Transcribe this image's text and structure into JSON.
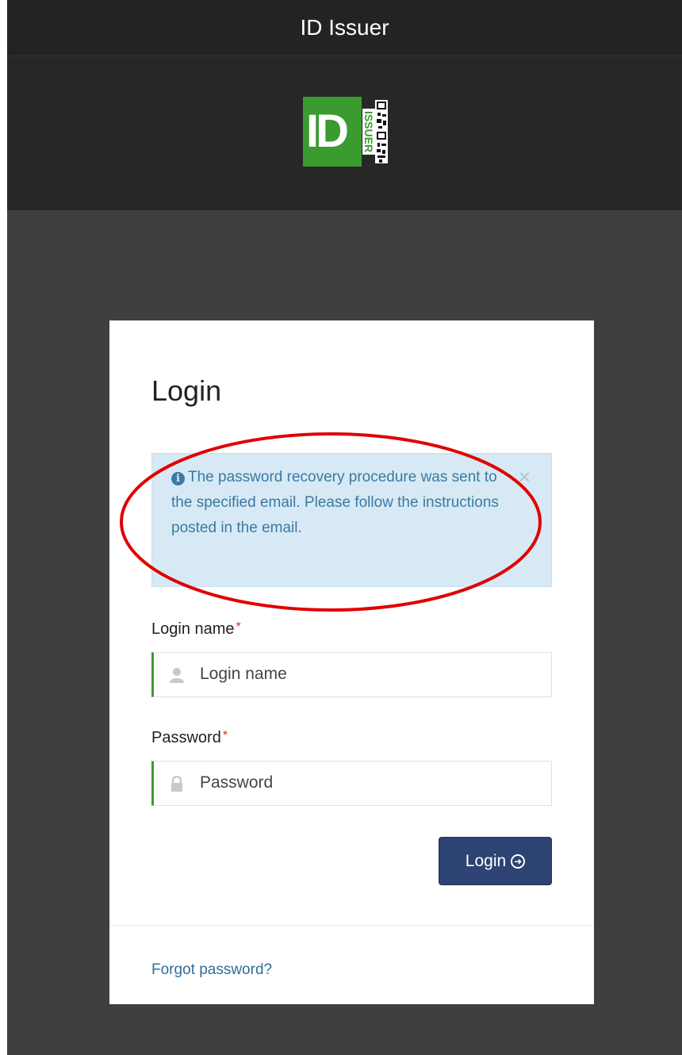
{
  "window": {
    "title": "ID Issuer"
  },
  "logo": {
    "big_text": "ID",
    "vertical_text": "ISSUER",
    "color": "#3a9b2f"
  },
  "login_form": {
    "title": "Login",
    "alert": {
      "message": "The password recovery procedure was sent to the specified email. Please follow the instructions posted in the email.",
      "close_symbol": "×",
      "icon": "info-icon"
    },
    "login_name": {
      "label": "Login name",
      "required_marker": "*",
      "placeholder": "Login name",
      "icon": "user-icon"
    },
    "password": {
      "label": "Password",
      "required_marker": "*",
      "placeholder": "Password",
      "icon": "lock-icon"
    },
    "submit": {
      "label": "Login",
      "icon": "arrow-circle-right-icon"
    },
    "forgot_link": "Forgot password?"
  },
  "colors": {
    "accent_green": "#3a9b2f",
    "button_blue": "#2d4373",
    "alert_bg": "#d7e9f4",
    "annotation_red": "#e00000"
  }
}
